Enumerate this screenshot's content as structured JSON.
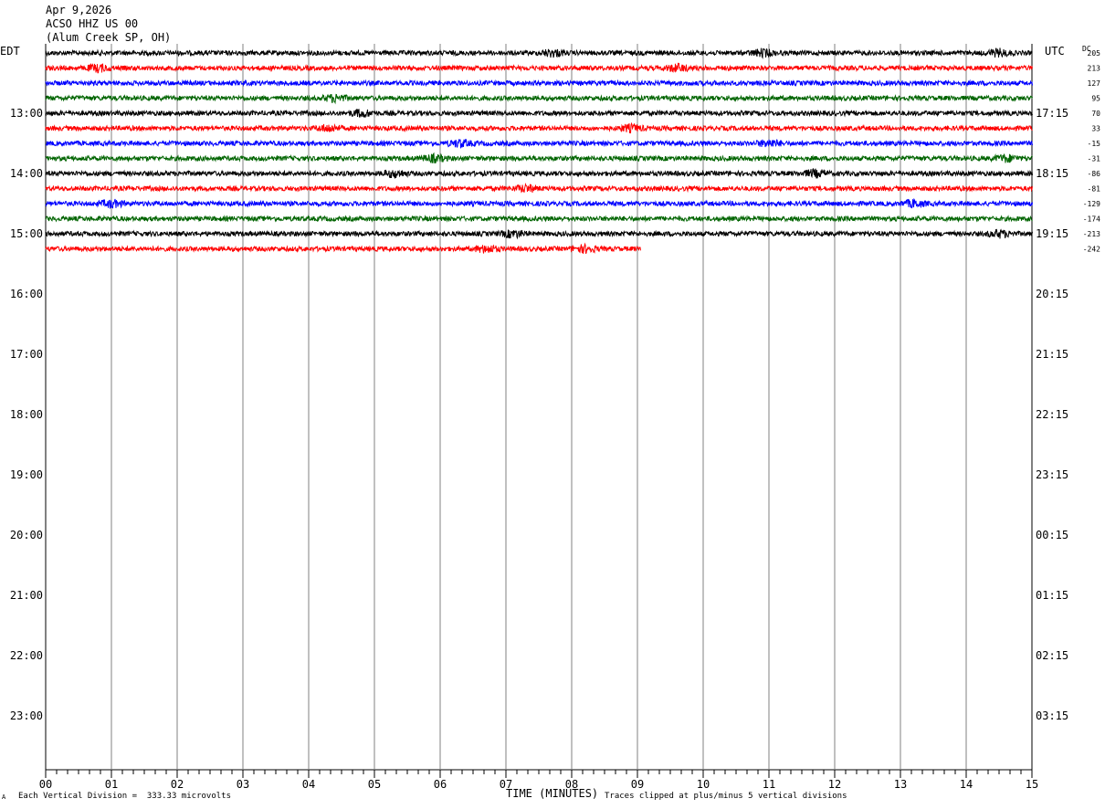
{
  "header": {
    "date": "Apr 9,2026",
    "station": "ACSO HHZ US 00",
    "location": "(Alum Creek SP, OH)"
  },
  "labels": {
    "left_tz": "EDT",
    "right_tz": "UTC",
    "dc": "DC",
    "xlabel": "TIME (MINUTES)",
    "scale_note": "Each Vertical Division =  333.33 microvolts",
    "clip_note": "Traces clipped at plus/minus 5 vertical divisions",
    "corner_mark": "A"
  },
  "colors": {
    "trace_cycle": [
      "#000000",
      "#ff0000",
      "#0000ff",
      "#006400"
    ],
    "grid": "#808080"
  },
  "chart_data": {
    "type": "line",
    "title": "ACSO HHZ US 00",
    "xlabel": "TIME (MINUTES)",
    "xlim": [
      0,
      15
    ],
    "x_ticks": [
      "00",
      "01",
      "02",
      "03",
      "04",
      "05",
      "06",
      "07",
      "08",
      "09",
      "10",
      "11",
      "12",
      "13",
      "14",
      "15"
    ],
    "left_hour_labels": [
      "13:00",
      "14:00",
      "15:00",
      "16:00",
      "17:00",
      "18:00",
      "19:00",
      "20:00",
      "21:00",
      "22:00",
      "23:00"
    ],
    "right_hour_labels": [
      "17:15",
      "18:15",
      "19:15",
      "20:15",
      "21:15",
      "22:15",
      "23:15",
      "00:15",
      "01:15",
      "02:15",
      "03:15"
    ],
    "dc_offsets": [
      "205",
      "213",
      "127",
      "95",
      "70",
      "33",
      "-15",
      "-31",
      "-86",
      "-81",
      "-129",
      "-174",
      "-213",
      "-242"
    ],
    "traces": [
      {
        "row": 0,
        "color": "#000000",
        "end_minute": 15,
        "events": [
          7.7,
          10.9,
          14.5
        ]
      },
      {
        "row": 1,
        "color": "#ff0000",
        "end_minute": 15,
        "events": [
          0.8,
          9.6
        ]
      },
      {
        "row": 2,
        "color": "#0000ff",
        "end_minute": 15,
        "events": []
      },
      {
        "row": 3,
        "color": "#006400",
        "end_minute": 15,
        "events": [
          4.4
        ]
      },
      {
        "row": 4,
        "color": "#000000",
        "end_minute": 15,
        "events": [
          4.8
        ]
      },
      {
        "row": 5,
        "color": "#ff0000",
        "end_minute": 15,
        "events": [
          4.3,
          8.9
        ]
      },
      {
        "row": 6,
        "color": "#0000ff",
        "end_minute": 15,
        "events": [
          6.3,
          11.0
        ]
      },
      {
        "row": 7,
        "color": "#006400",
        "end_minute": 15,
        "events": [
          5.9,
          14.6
        ]
      },
      {
        "row": 8,
        "color": "#000000",
        "end_minute": 15,
        "events": [
          5.3,
          11.7
        ]
      },
      {
        "row": 9,
        "color": "#ff0000",
        "end_minute": 15,
        "events": [
          7.3
        ]
      },
      {
        "row": 10,
        "color": "#0000ff",
        "end_minute": 15,
        "events": [
          1.0,
          13.2
        ]
      },
      {
        "row": 11,
        "color": "#006400",
        "end_minute": 15,
        "events": []
      },
      {
        "row": 12,
        "color": "#000000",
        "end_minute": 15,
        "events": [
          7.1,
          14.5
        ]
      },
      {
        "row": 13,
        "color": "#ff0000",
        "end_minute": 9.05,
        "events": [
          6.7,
          8.2
        ]
      }
    ],
    "traces_per_hour": 4,
    "grid": true
  }
}
